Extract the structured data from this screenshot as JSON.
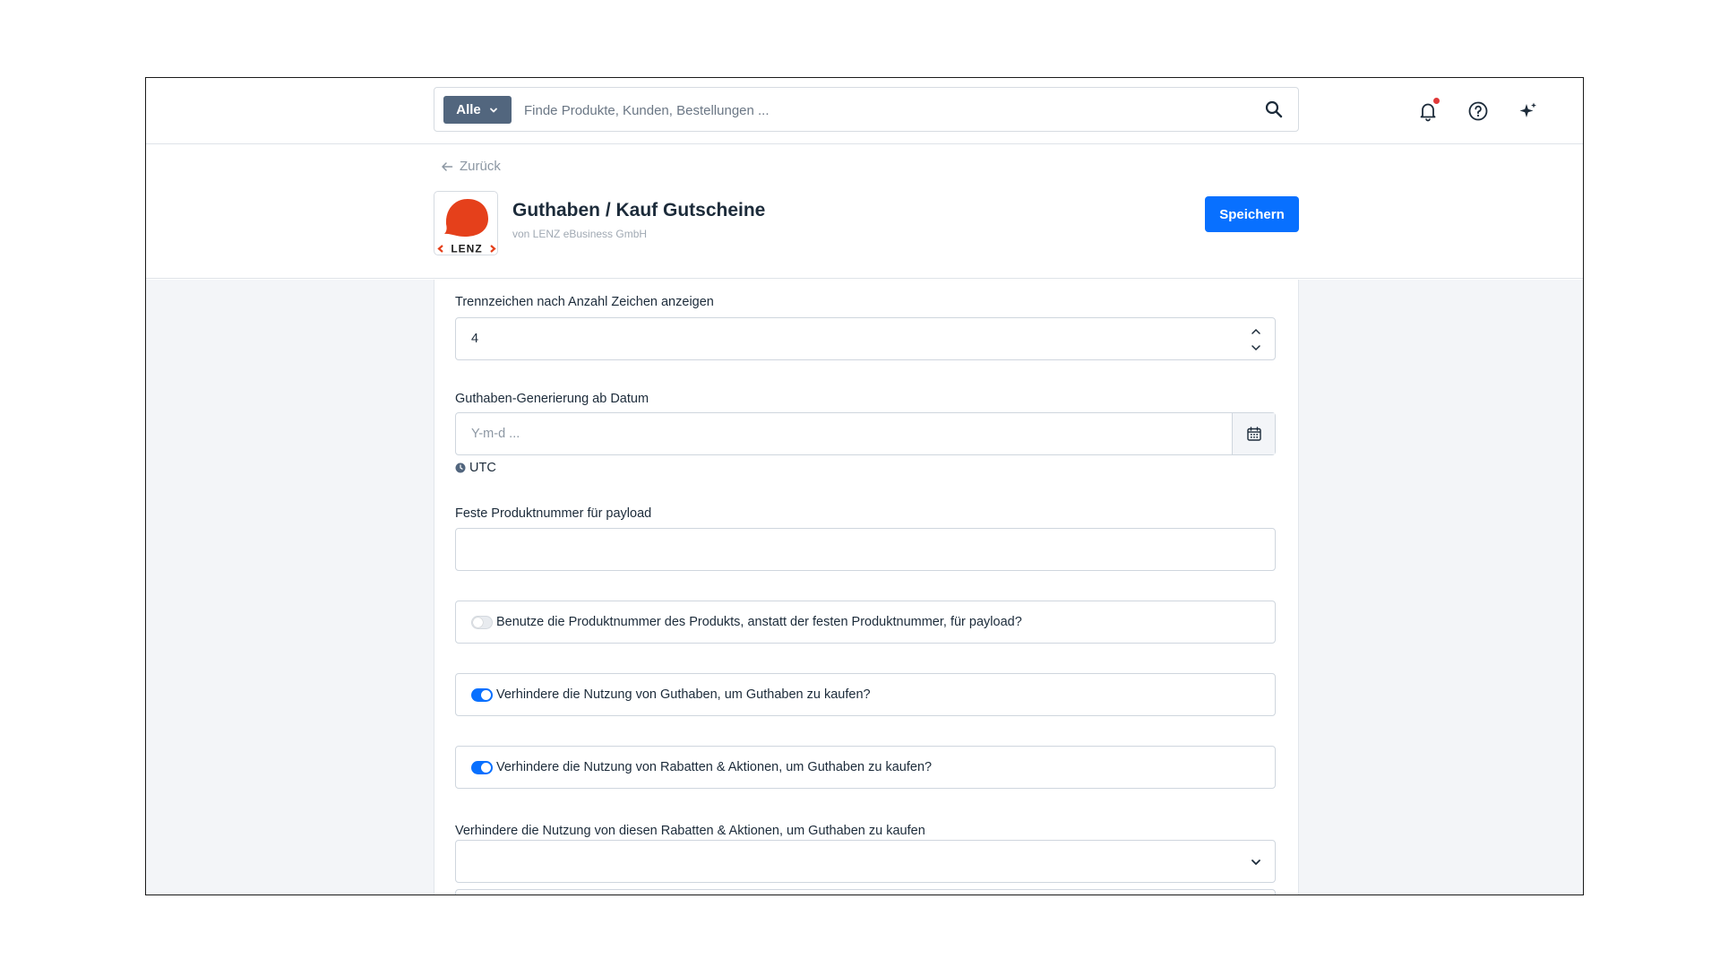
{
  "search": {
    "scope_label": "Alle",
    "placeholder": "Finde Produkte, Kunden, Bestellungen ..."
  },
  "icons": {
    "search": "search-icon",
    "bell": "bell-icon",
    "help": "help-icon",
    "ai": "sparkles-icon"
  },
  "header": {
    "back_label": "Zurück",
    "title": "Guthaben / Kauf Gutscheine",
    "vendor": "von LENZ eBusiness GmbH",
    "logo_text": "LENZ",
    "save_label": "Speichern"
  },
  "form": {
    "separator": {
      "label": "Trennzeichen nach Anzahl Zeichen anzeigen",
      "value": "4"
    },
    "date": {
      "label": "Guthaben-Generierung ab Datum",
      "placeholder": "Y-m-d ...",
      "timezone": "UTC"
    },
    "product_number": {
      "label": "Feste Produktnummer für payload",
      "value": ""
    },
    "toggles": [
      {
        "label": "Benutze die Produktnummer des Produkts, anstatt der festen Produktnummer, für payload?",
        "on": false
      },
      {
        "label": "Verhindere die Nutzung von Guthaben, um Guthaben zu kaufen?",
        "on": true
      },
      {
        "label": "Verhindere die Nutzung von Rabatten & Aktionen, um Guthaben zu kaufen?",
        "on": true
      }
    ],
    "promotions": {
      "label": "Verhindere die Nutzung von diesen Rabatten & Aktionen, um Guthaben zu kaufen",
      "value": ""
    }
  },
  "colors": {
    "primary": "#0870ff",
    "scope_bg": "#52667e",
    "logo_red": "#e5401b",
    "notification_dot": "#e03939",
    "content_bg": "#f3f5f8"
  }
}
